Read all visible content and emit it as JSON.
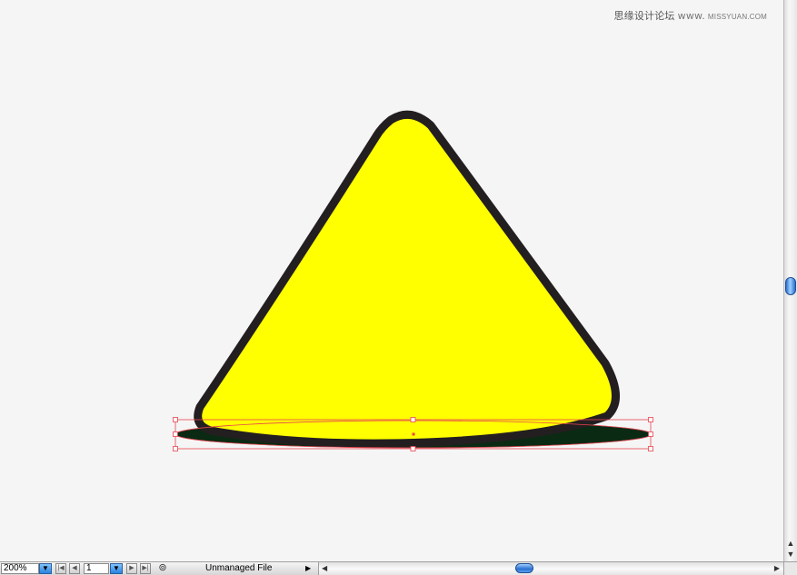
{
  "watermark": {
    "text": "思缘设计论坛",
    "separator": "www.",
    "url": "MISSYUAN.COM"
  },
  "artwork": {
    "triangle_fill": "#ffff00",
    "triangle_stroke": "#231f20",
    "shadow_fill": "#0b2a13",
    "selection_color": "#e8434f"
  },
  "statusbar": {
    "zoom": "200%",
    "zoom_dropdown_icon": "chevron-down-icon",
    "first_page_icon": "first-page-icon",
    "prev_page_icon": "prev-page-icon",
    "page": "1",
    "page_dropdown_icon": "chevron-down-icon",
    "next_page_icon": "next-page-icon",
    "last_page_icon": "last-page-icon",
    "status_text": "Unmanaged File"
  },
  "scrollbars": {
    "accent": "#2a6fd0"
  }
}
